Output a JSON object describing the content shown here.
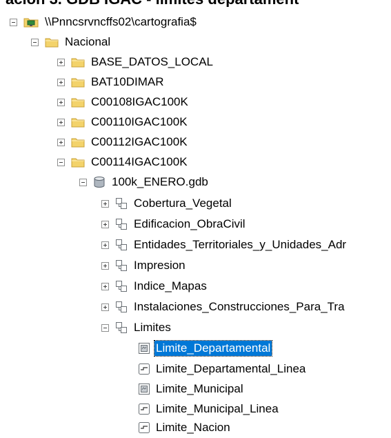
{
  "header_fragment": "ación 3. GDB IGAC - límites departament",
  "tree": {
    "root": {
      "label": "\\\\Pnncsrvncffs02\\cartografia$"
    },
    "nacional": {
      "label": "Nacional"
    },
    "folders": [
      {
        "label": "BASE_DATOS_LOCAL"
      },
      {
        "label": "BAT10DIMAR"
      },
      {
        "label": "C00108IGAC100K"
      },
      {
        "label": "C00110IGAC100K"
      },
      {
        "label": "C00112IGAC100K"
      },
      {
        "label": "C00114IGAC100K"
      }
    ],
    "gdb": {
      "label": "100k_ENERO.gdb"
    },
    "datasets": [
      {
        "label": "Cobertura_Vegetal"
      },
      {
        "label": "Edificacion_ObraCivil"
      },
      {
        "label": "Entidades_Territoriales_y_Unidades_Adr"
      },
      {
        "label": "Impresion"
      },
      {
        "label": "Indice_Mapas"
      },
      {
        "label": "Instalaciones_Construcciones_Para_Tra"
      },
      {
        "label": "Limites"
      }
    ],
    "feature_classes": [
      {
        "label": "Limite_Departamental",
        "type": "polygon",
        "selected": true
      },
      {
        "label": "Limite_Departamental_Linea",
        "type": "line"
      },
      {
        "label": "Limite_Municipal",
        "type": "polygon"
      },
      {
        "label": "Limite_Municipal_Linea",
        "type": "line"
      },
      {
        "label": "Limite_Nacion",
        "type": "line"
      }
    ]
  },
  "colors": {
    "selection": "#0078d7",
    "folder": "#f3d36b",
    "folder_edge": "#c8a23a"
  }
}
